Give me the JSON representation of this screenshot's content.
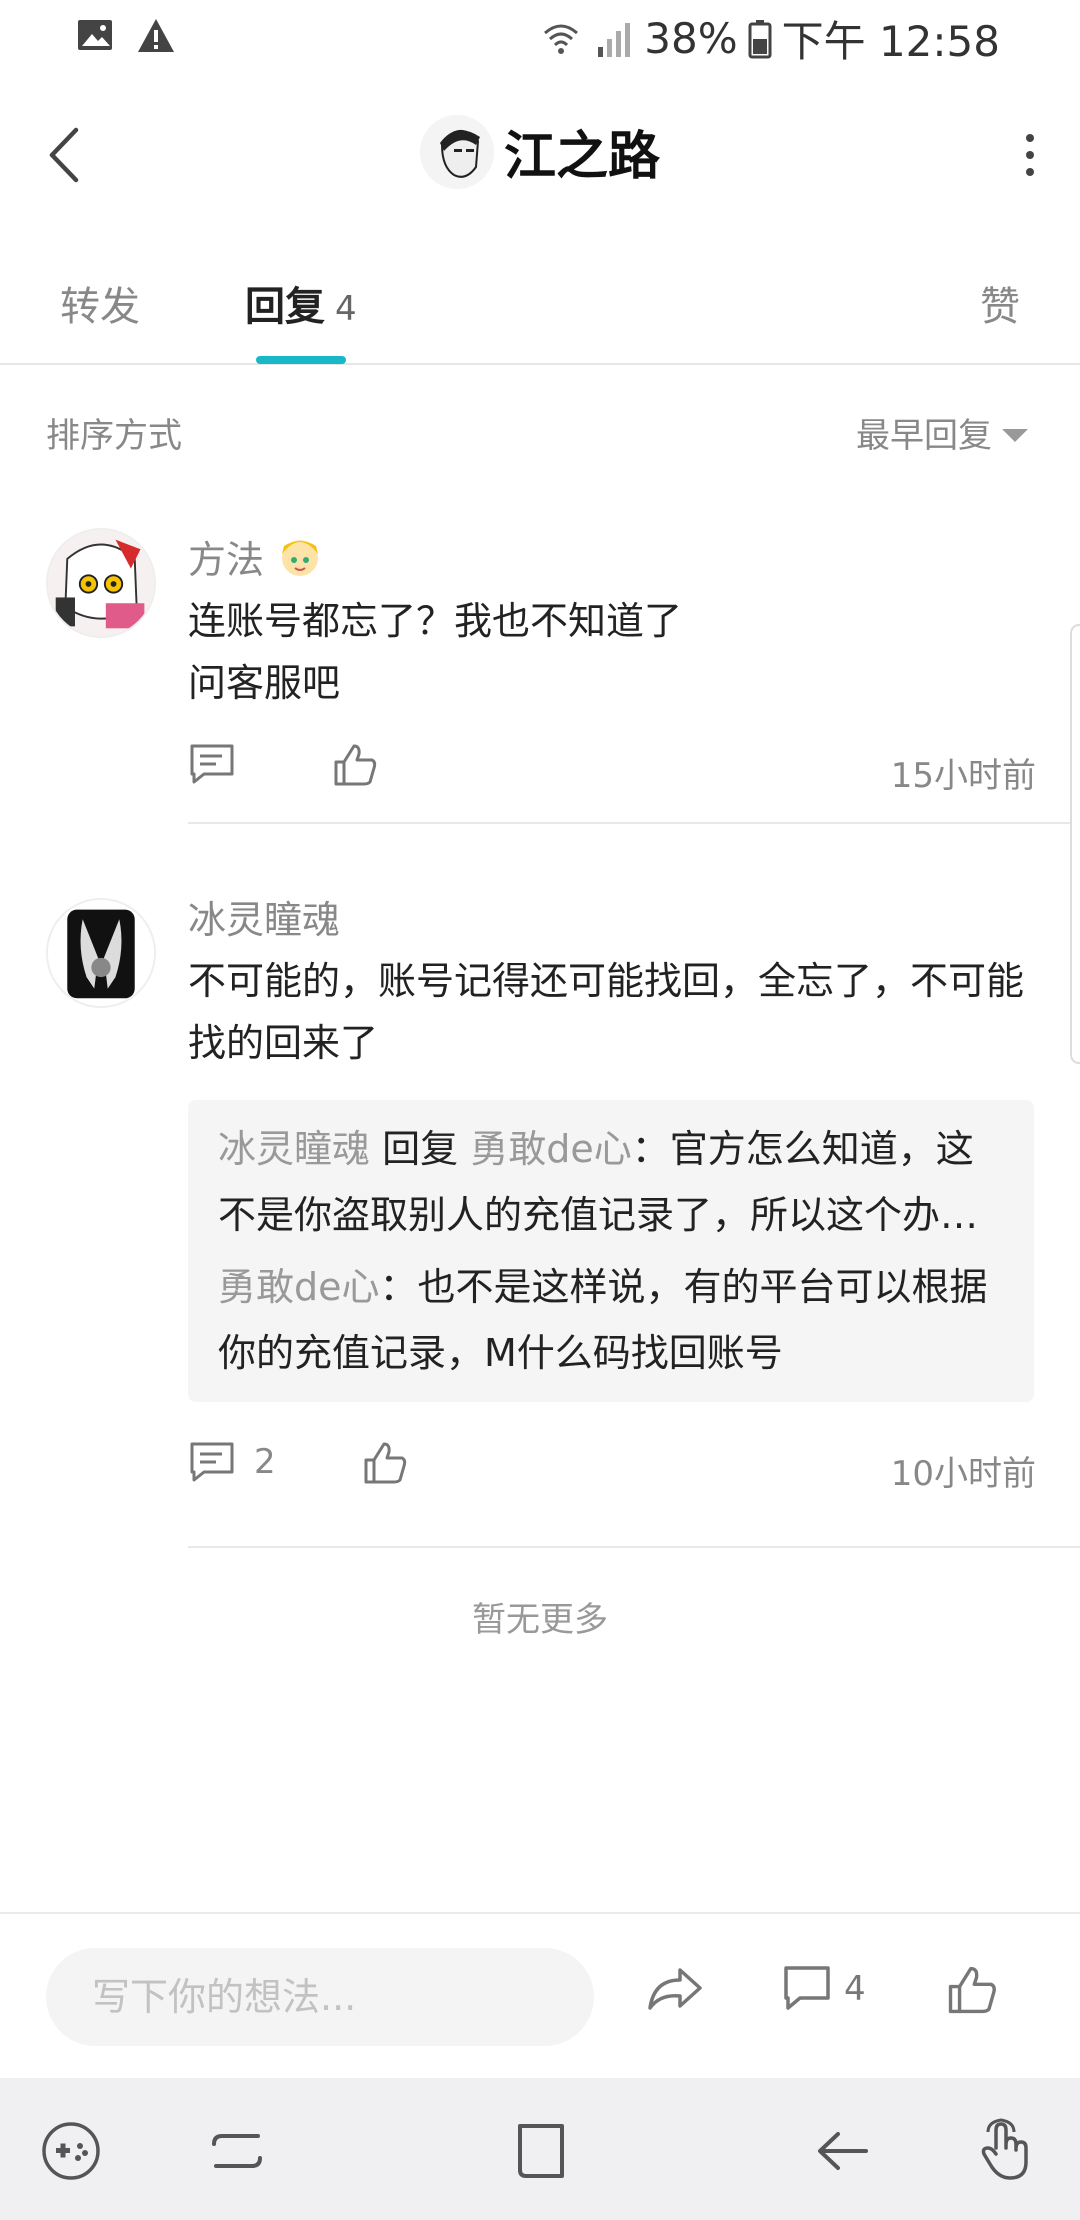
{
  "status_bar": {
    "battery": "38%",
    "time": "下午 12:58"
  },
  "header": {
    "title": "江之路"
  },
  "tabs": {
    "forward": "转发",
    "reply": "回复",
    "reply_count": "4",
    "like": "赞",
    "active": "回复"
  },
  "sort": {
    "label": "排序方式",
    "value": "最早回复"
  },
  "comments": [
    {
      "name": "方法",
      "line1": "连账号都忘了？我也不知道了",
      "line2": "问客服吧",
      "reply_count": "",
      "time": "15小时前"
    },
    {
      "name": "冰灵瞳魂",
      "text": "不可能的，账号记得还可能找回，全忘了，不可能找的回来了",
      "replies": [
        {
          "user": "冰灵瞳魂",
          "reply_word": "回复",
          "to": "勇敢de心",
          "text": "：官方怎么知道，这不是你盗取别人的充值记录了，所以这个办法没法找回"
        },
        {
          "user": "勇敢de心",
          "text": "：也不是这样说，有的平台可以根据你的充值记录，M什么码找回账号"
        }
      ],
      "reply_count": "2",
      "time": "10小时前"
    }
  ],
  "no_more": "暂无更多",
  "input_bar": {
    "placeholder": "写下你的想法...",
    "comment_count": "4"
  },
  "colors": {
    "accent": "#19b8c8",
    "muted_text": "#888888",
    "reply_bg": "#f5f5f5",
    "nav_bg": "#f0f0f2"
  }
}
